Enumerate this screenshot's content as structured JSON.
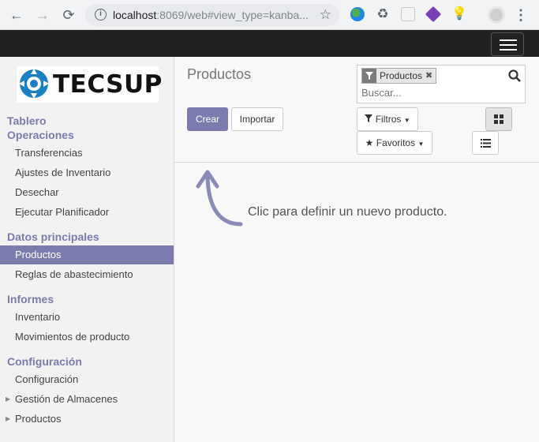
{
  "browser": {
    "url_host": "localhost",
    "url_path": ":8069/web#view_type=kanba..."
  },
  "brand": {
    "logo_text": "TECSUP",
    "accent": "#7c7bad",
    "topbar": "#212121"
  },
  "sidebar": {
    "sections": [
      {
        "title": "Tablero"
      },
      {
        "title": "Operaciones",
        "items": [
          "Transferencias",
          "Ajustes de Inventario",
          "Desechar",
          "Ejecutar Planificador"
        ]
      },
      {
        "title": "Datos principales",
        "items": [
          "Productos",
          "Reglas de abastecimiento"
        ]
      },
      {
        "title": "Informes",
        "items": [
          "Inventario",
          "Movimientos de producto"
        ]
      },
      {
        "title": "Configuración",
        "items": [
          "Configuración",
          "Gestión de Almacenes",
          "Productos"
        ]
      }
    ],
    "active_item": "Productos"
  },
  "main": {
    "title": "Productos",
    "create_label": "Crear",
    "import_label": "Importar",
    "search_facet": "Productos",
    "search_placeholder": "Buscar...",
    "filters_label": "Filtros",
    "favorites_label": "Favoritos",
    "helper_text": "Clic para definir un nuevo producto.",
    "active_view": "kanban"
  }
}
